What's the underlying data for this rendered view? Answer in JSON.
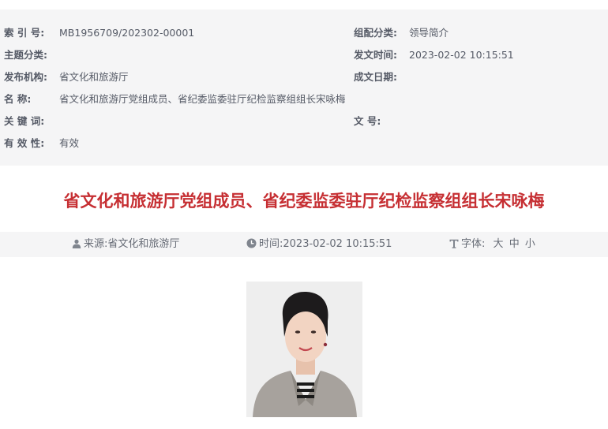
{
  "meta": {
    "index": {
      "label": "索 引 号:",
      "value": "MB1956709/202302-00001"
    },
    "category": {
      "label": "组配分类:",
      "value": "领导简介"
    },
    "topic": {
      "label": "主题分类:",
      "value": ""
    },
    "publish_time": {
      "label": "发文时间:",
      "value": "2023-02-02 10:15:51"
    },
    "publisher": {
      "label": "发布机构:",
      "value": "省文化和旅游厅"
    },
    "created_date": {
      "label": "成文日期:",
      "value": ""
    },
    "name": {
      "label": "名 称:",
      "value": "省文化和旅游厅党组成员、省纪委监委驻厅纪检监察组组长宋咏梅"
    },
    "keywords": {
      "label": "关 键 词:",
      "value": ""
    },
    "doc_number": {
      "label": "文 号:",
      "value": ""
    },
    "validity": {
      "label": "有 效 性:",
      "value": "有效"
    }
  },
  "article": {
    "title": "省文化和旅游厅党组成员、省纪委监委驻厅纪检监察组组长宋咏梅",
    "source": "来源:省文化和旅游厅",
    "time": "时间:2023-02-02 10:15:51",
    "font_label": "字体:",
    "font_sizes": [
      "大",
      "中",
      "小"
    ]
  },
  "colors": {
    "title": "#c62f33",
    "meta_bg": "#f5f5f6",
    "text": "#555a66"
  },
  "icons": {
    "source": "user-icon",
    "time": "clock-icon",
    "font": "font-size-icon"
  }
}
